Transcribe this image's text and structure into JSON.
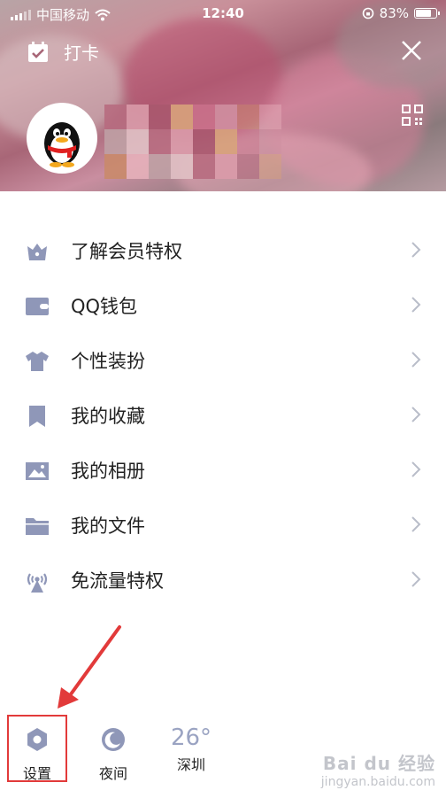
{
  "status_bar": {
    "carrier": "中国移动",
    "time": "12:40",
    "battery": "83%",
    "battery_level": 0.83
  },
  "header": {
    "checkin_label": "打卡",
    "close_icon": "close-icon",
    "qr_icon": "qr-code-icon"
  },
  "menu": {
    "items": [
      {
        "label": "了解会员特权",
        "icon": "crown-icon"
      },
      {
        "label": "QQ钱包",
        "icon": "wallet-icon"
      },
      {
        "label": "个性装扮",
        "icon": "tshirt-icon"
      },
      {
        "label": "我的收藏",
        "icon": "bookmark-icon"
      },
      {
        "label": "我的相册",
        "icon": "photo-icon"
      },
      {
        "label": "我的文件",
        "icon": "folder-icon"
      },
      {
        "label": "免流量特权",
        "icon": "antenna-icon"
      }
    ]
  },
  "bottom": {
    "settings_label": "设置",
    "night_label": "夜间",
    "weather_temp": "26°",
    "weather_city": "深圳"
  },
  "watermark": {
    "brand": "Bai du 经验",
    "url": "jingyan.baidu.com"
  },
  "colors": {
    "icon": "#8f97b8",
    "text": "#222222",
    "chevron": "#b9bdc9",
    "arrow": "#e23a3a"
  }
}
